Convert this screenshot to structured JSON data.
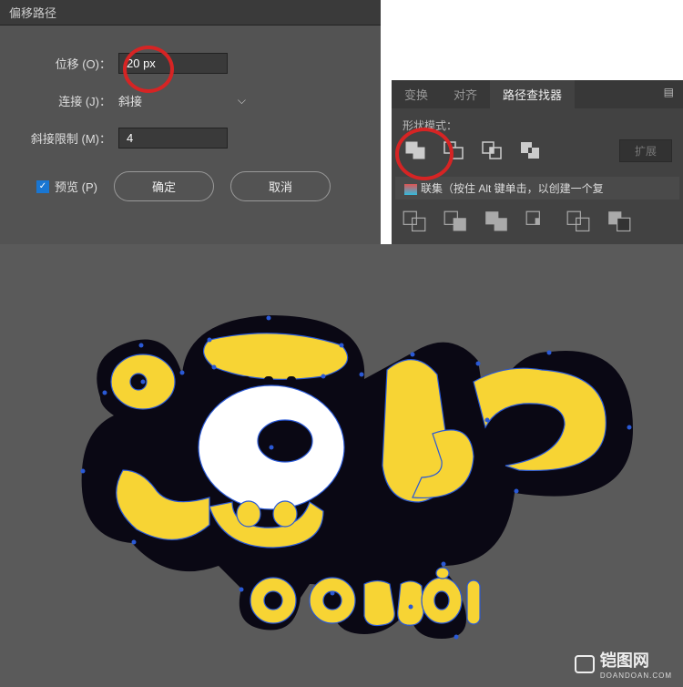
{
  "dialog": {
    "title": "偏移路径",
    "offset_label": "位移 (O)：",
    "offset_value": "20 px",
    "join_label": "连接 (J)：",
    "join_value": "斜接",
    "miter_label": "斜接限制 (M)：",
    "miter_value": "4",
    "preview_label": "预览 (P)",
    "ok": "确定",
    "cancel": "取消"
  },
  "panel": {
    "tabs": {
      "transform": "变换",
      "align": "对齐",
      "pathfinder": "路径查找器"
    },
    "section": "形状模式：",
    "tooltip": "联集（按住 Alt 键单击，以创建一个复",
    "expand": "扩展"
  },
  "watermark": {
    "brand": "铠图网",
    "url": "DOANDOAN.COM"
  }
}
